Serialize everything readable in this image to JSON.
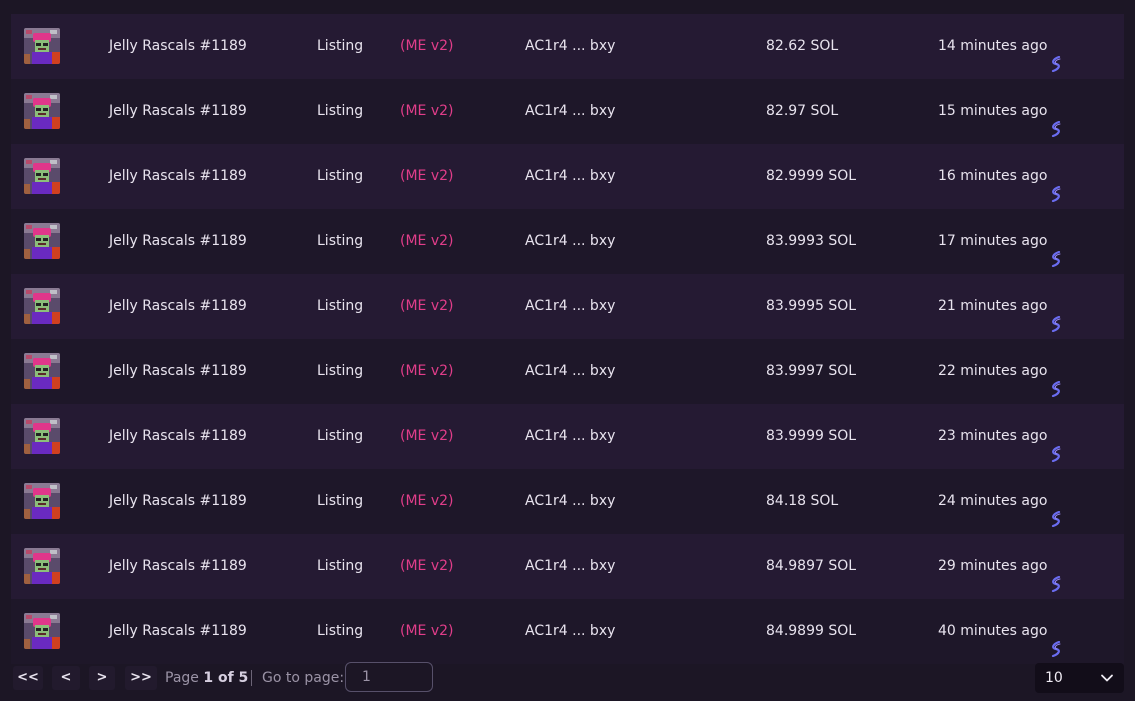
{
  "rows": [
    {
      "name": "Jelly Rascals #1189",
      "type": "Listing",
      "market": "(ME v2)",
      "seller": "AC1r4 ... bxy",
      "price": "82.62 SOL",
      "time": "14 minutes ago"
    },
    {
      "name": "Jelly Rascals #1189",
      "type": "Listing",
      "market": "(ME v2)",
      "seller": "AC1r4 ... bxy",
      "price": "82.97 SOL",
      "time": "15 minutes ago"
    },
    {
      "name": "Jelly Rascals #1189",
      "type": "Listing",
      "market": "(ME v2)",
      "seller": "AC1r4 ... bxy",
      "price": "82.9999 SOL",
      "time": "16 minutes ago"
    },
    {
      "name": "Jelly Rascals #1189",
      "type": "Listing",
      "market": "(ME v2)",
      "seller": "AC1r4 ... bxy",
      "price": "83.9993 SOL",
      "time": "17 minutes ago"
    },
    {
      "name": "Jelly Rascals #1189",
      "type": "Listing",
      "market": "(ME v2)",
      "seller": "AC1r4 ... bxy",
      "price": "83.9995 SOL",
      "time": "21 minutes ago"
    },
    {
      "name": "Jelly Rascals #1189",
      "type": "Listing",
      "market": "(ME v2)",
      "seller": "AC1r4 ... bxy",
      "price": "83.9997 SOL",
      "time": "22 minutes ago"
    },
    {
      "name": "Jelly Rascals #1189",
      "type": "Listing",
      "market": "(ME v2)",
      "seller": "AC1r4 ... bxy",
      "price": "83.9999 SOL",
      "time": "23 minutes ago"
    },
    {
      "name": "Jelly Rascals #1189",
      "type": "Listing",
      "market": "(ME v2)",
      "seller": "AC1r4 ... bxy",
      "price": "84.18 SOL",
      "time": "24 minutes ago"
    },
    {
      "name": "Jelly Rascals #1189",
      "type": "Listing",
      "market": "(ME v2)",
      "seller": "AC1r4 ... bxy",
      "price": "84.9897 SOL",
      "time": "29 minutes ago"
    },
    {
      "name": "Jelly Rascals #1189",
      "type": "Listing",
      "market": "(ME v2)",
      "seller": "AC1r4 ... bxy",
      "price": "84.9899 SOL",
      "time": "40 minutes ago"
    }
  ],
  "pagination": {
    "first_label": "<<",
    "prev_label": "<",
    "next_label": ">",
    "last_label": ">>",
    "page_word": "Page",
    "current_page": "1 of 5",
    "goto_label": "Go to page:",
    "goto_value": "1",
    "page_size": "10"
  },
  "colors": {
    "background": "#1c1625",
    "row_odd": "#251a33",
    "row_even": "#1e1729",
    "market_accent": "#e23d8a",
    "sol_icon": "#6a6cf0"
  },
  "icons": {
    "nft_thumbnail": "nft-avatar-icon",
    "time_link": "solana-explorer-icon",
    "page_size_dropdown": "chevron-down-icon"
  }
}
